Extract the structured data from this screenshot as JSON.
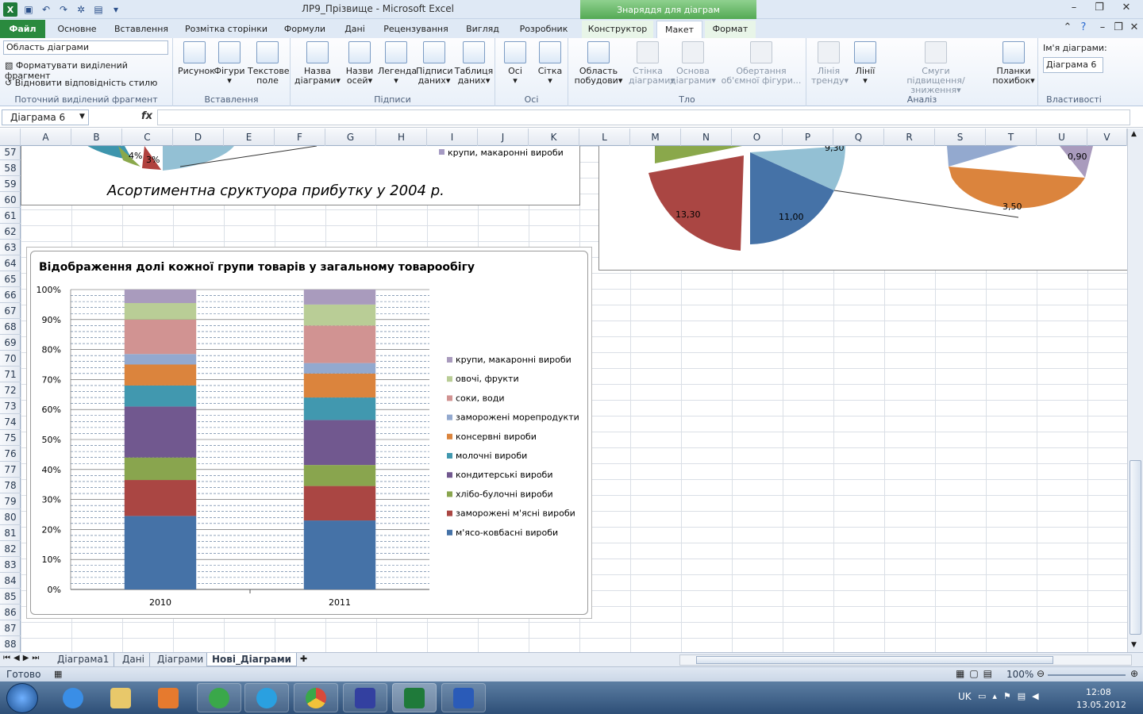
{
  "titlebar": {
    "title": "ЛР9_Прізвище - Microsoft Excel",
    "context_header": "Знаряддя для діаграм"
  },
  "tabs": {
    "file": "Файл",
    "items": [
      "Основне",
      "Вставлення",
      "Розмітка сторінки",
      "Формули",
      "Дані",
      "Рецензування",
      "Вигляд",
      "Розробник",
      "Конструктор",
      "Макет",
      "Формат"
    ],
    "active": "Макет"
  },
  "ribbon": {
    "current_selection": {
      "combo_value": "Область діаграми",
      "format_btn": "Форматувати виділений фрагмент",
      "reset_btn": "Відновити відповідність стилю",
      "label": "Поточний виділений фрагмент"
    },
    "insert": {
      "label": "Вставлення",
      "picture": "Рисунок",
      "shapes": "Фігури",
      "textbox_1": "Текстове",
      "textbox_2": "поле"
    },
    "labels": {
      "label": "Підписи",
      "chart_title_1": "Назва",
      "chart_title_2": "діаграми",
      "axis_titles_1": "Назви",
      "axis_titles_2": "осей",
      "legend": "Легенда",
      "data_labels_1": "Підписи",
      "data_labels_2": "даних",
      "data_table_1": "Таблиця",
      "data_table_2": "даних"
    },
    "axes": {
      "label": "Осі",
      "axes": "Осі",
      "gridlines": "Сітка"
    },
    "background": {
      "label": "Тло",
      "plot_area_1": "Область",
      "plot_area_2": "побудови",
      "chart_wall_1": "Стінка",
      "chart_wall_2": "діаграми",
      "chart_floor_1": "Основа",
      "chart_floor_2": "діаграми",
      "rotation_1": "Обертання",
      "rotation_2": "об'ємної фігури..."
    },
    "analysis": {
      "label": "Аналіз",
      "trendline_1": "Лінія",
      "trendline_2": "тренду",
      "lines": "Лінії",
      "updown_1": "Смуги",
      "updown_2": "підвищення/зниження",
      "error_bars_1": "Планки",
      "error_bars_2": "похибок"
    },
    "properties": {
      "label": "Властивості",
      "chart_name_caption": "Ім'я діаграми:",
      "chart_name_value": "Діаграма 6"
    }
  },
  "formulabar": {
    "namebox": "Діаграма 6",
    "fx": "fx",
    "formula": ""
  },
  "grid": {
    "columns": [
      "A",
      "B",
      "C",
      "D",
      "E",
      "F",
      "G",
      "H",
      "I",
      "J",
      "K",
      "L",
      "M",
      "N",
      "O",
      "P",
      "Q",
      "R",
      "S",
      "T",
      "U",
      "V"
    ],
    "rows": [
      "57",
      "58",
      "59",
      "60",
      "61",
      "62",
      "63",
      "64",
      "65",
      "66",
      "67",
      "68",
      "69",
      "70",
      "71",
      "72",
      "73",
      "74",
      "75",
      "76",
      "77",
      "78",
      "79",
      "80",
      "81",
      "82",
      "83",
      "84",
      "85",
      "86",
      "87",
      "88"
    ]
  },
  "top_left_chart": {
    "title": "Асортиментна сруктуора прибутку у 2004 р.",
    "label_4": "4%",
    "label_3": "3%",
    "legend_item": "крупи, макаронні вироби",
    "colors": {
      "green": "#8aa84b",
      "red": "#b0413e",
      "lightblue": "#93c0d4",
      "teal": "#3e95ad",
      "purple": "#a59ac3"
    }
  },
  "top_right_chart": {
    "label_930": "9,30",
    "label_1330": "13,30",
    "label_1100": "11,00",
    "label_090": "0,90",
    "label_350": "3,50"
  },
  "chart_data": {
    "type": "bar",
    "stacked": "100%",
    "title": "Відображення долі кожної групи товарів у загальному товарообігу",
    "categories": [
      "2010",
      "2011"
    ],
    "ylim": [
      0,
      100
    ],
    "yticks": [
      "0%",
      "10%",
      "20%",
      "30%",
      "40%",
      "50%",
      "60%",
      "70%",
      "80%",
      "90%",
      "100%"
    ],
    "grid": true,
    "legend_position": "right",
    "series": [
      {
        "name": "м'ясо-ковбасні вироби",
        "color": "#4572a7",
        "values": [
          24.5,
          23
        ]
      },
      {
        "name": "заморожені м'ясні вироби",
        "color": "#aa4643",
        "values": [
          12,
          11.5
        ]
      },
      {
        "name": "хлібо-булочні вироби",
        "color": "#89a54e",
        "values": [
          7.5,
          7
        ]
      },
      {
        "name": "кондитерські  вироби",
        "color": "#71588f",
        "values": [
          17,
          15
        ]
      },
      {
        "name": "молочні вироби",
        "color": "#4198af",
        "values": [
          7,
          7.5
        ]
      },
      {
        "name": "консервні вироби",
        "color": "#db843d",
        "values": [
          7,
          8
        ]
      },
      {
        "name": "заморожені морепродукти",
        "color": "#93a9cf",
        "values": [
          3.5,
          3.5
        ]
      },
      {
        "name": "соки, води",
        "color": "#d19392",
        "values": [
          11.5,
          12.5
        ]
      },
      {
        "name": "овочі, фрукти",
        "color": "#b9cd96",
        "values": [
          5.5,
          7
        ]
      },
      {
        "name": "крупи, макаронні вироби",
        "color": "#a99bbd",
        "values": [
          4.5,
          5
        ]
      }
    ]
  },
  "sheets": {
    "tabs": [
      "Діаграма1",
      "Дані",
      "Діаграми",
      "Нові_Діаграми"
    ],
    "active": "Нові_Діаграми"
  },
  "statusbar": {
    "status": "Готово",
    "zoom": "100%"
  },
  "taskbar": {
    "lang": "UK",
    "time": "12:08",
    "date": "13.05.2012"
  }
}
